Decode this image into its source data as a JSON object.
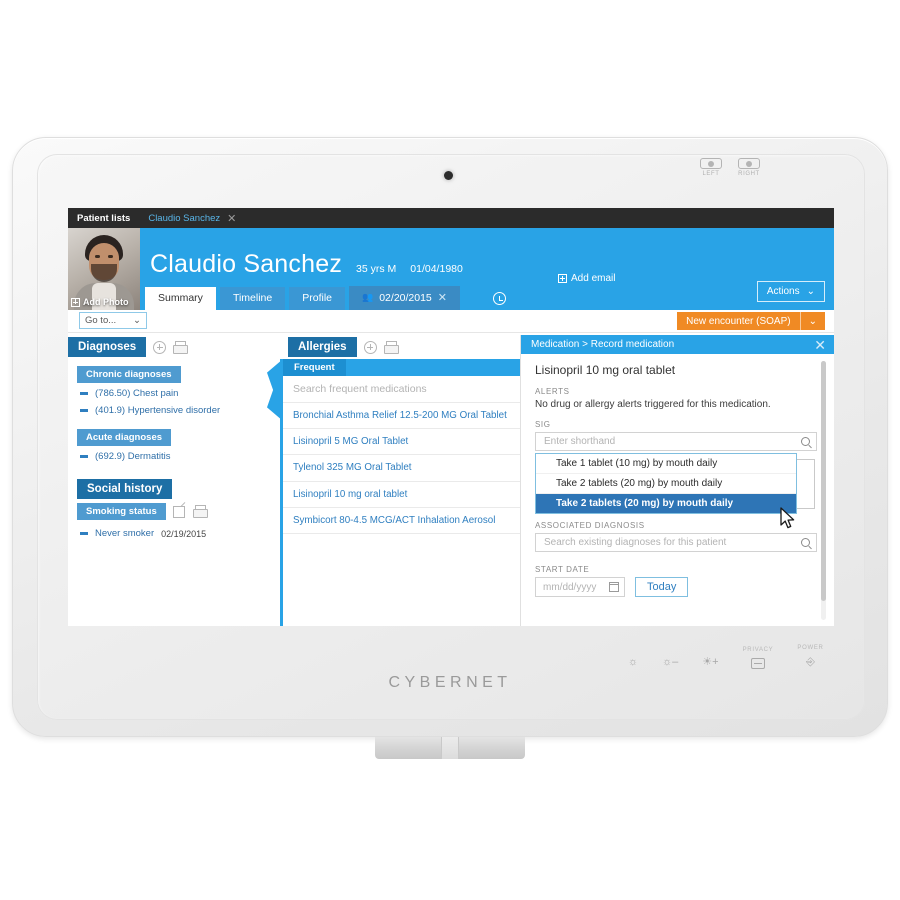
{
  "device": {
    "brand": "CYBERNET",
    "bezel_indicators": [
      {
        "name": "camera-left-indicator",
        "label": "LEFT"
      },
      {
        "name": "camera-right-indicator",
        "label": "RIGHT"
      }
    ],
    "bottom_controls": [
      {
        "name": "function-button",
        "label": "",
        "icon": "brightness-dot-icon"
      },
      {
        "name": "brightness-down-button",
        "label": "",
        "icon": "brightness-down-icon"
      },
      {
        "name": "brightness-up-button",
        "label": "",
        "icon": "brightness-up-icon"
      },
      {
        "name": "privacy-button",
        "label": "PRIVACY",
        "icon": "privacy-screen-icon"
      },
      {
        "name": "power-button",
        "label": "POWER",
        "icon": "power-icon"
      }
    ]
  },
  "topbar": {
    "patient_lists_label": "Patient lists",
    "open_tab_label": "Claudio Sanchez",
    "close_glyph": "✕"
  },
  "patient": {
    "name": "Claudio Sanchez",
    "age_sex": "35 yrs M",
    "dob": "01/04/1980",
    "add_photo_label": "Add Photo",
    "add_email_label": "Add email",
    "actions_label": "Actions",
    "actions_caret": "⌄"
  },
  "tabs": [
    {
      "label": "Summary",
      "active": true
    },
    {
      "label": "Timeline",
      "active": false
    },
    {
      "label": "Profile",
      "active": false
    },
    {
      "label": "02/20/2015",
      "active": false,
      "encounter": true
    }
  ],
  "toolbar": {
    "goto_label": "Go to...",
    "goto_caret": "⌄",
    "new_encounter_label": "New encounter (SOAP)",
    "new_encounter_caret": "⌄"
  },
  "diagnoses_panel": {
    "title": "Diagnoses",
    "add_icon": "plus-circle-icon",
    "print_icon": "printer-icon",
    "sections": [
      {
        "title": "Chronic diagnoses",
        "items": [
          {
            "text": "(786.50) Chest pain",
            "date": ""
          },
          {
            "text": "(401.9) Hypertensive disorder",
            "date": ""
          }
        ]
      },
      {
        "title": "Acute diagnoses",
        "items": [
          {
            "text": "(692.9) Dermatitis",
            "date": ""
          }
        ]
      }
    ],
    "social_history_title": "Social history",
    "smoking_status_title": "Smoking status",
    "smoking_items": [
      {
        "text": "Never smoker",
        "date": "02/19/2015"
      }
    ]
  },
  "allergies_panel": {
    "title": "Allergies",
    "add_icon": "plus-circle-icon",
    "print_icon": "printer-icon"
  },
  "frequent_panel": {
    "tab_label": "Frequent",
    "search_placeholder": "Search frequent medications",
    "medications": [
      "Bronchial Asthma Relief 12.5-200 MG Oral Tablet",
      "Lisinopril 5 MG Oral Tablet",
      "Tylenol 325 MG Oral Tablet",
      "Lisinopril 10 mg oral tablet",
      "Symbicort 80-4.5 MCG/ACT Inhalation Aerosol"
    ]
  },
  "medication_modal": {
    "breadcrumb": "Medication > Record medication",
    "close_glyph": "✕",
    "med_name": "Lisinopril 10 mg oral tablet",
    "alerts_label": "ALERTS",
    "alerts_text": "No drug or allergy alerts triggered for this medication.",
    "sig_label": "SIG",
    "sig_placeholder": "Enter shorthand",
    "sig_options": [
      {
        "text": "Take 1 tablet (10 mg) by mouth daily",
        "selected": false
      },
      {
        "text": "Take 2 tablets (20 mg) by mouth daily",
        "selected": false
      },
      {
        "text": "Take 2 tablets (20 mg) by mouth daily",
        "selected": true
      }
    ],
    "assoc_label": "ASSOCIATED DIAGNOSIS",
    "assoc_placeholder": "Search existing diagnoses for this patient",
    "start_date_label": "START DATE",
    "start_date_placeholder": "mm/dd/yyyy",
    "today_label": "Today",
    "search_icon": "magnifier-icon",
    "calendar_icon": "calendar-icon"
  },
  "colors": {
    "brand_blue": "#29a3e6",
    "dark_blue": "#1d6fa5",
    "mid_blue": "#4f9bd0",
    "select_blue": "#2e75b6",
    "orange": "#f08a24",
    "topbar_black": "#2b2b2b"
  }
}
